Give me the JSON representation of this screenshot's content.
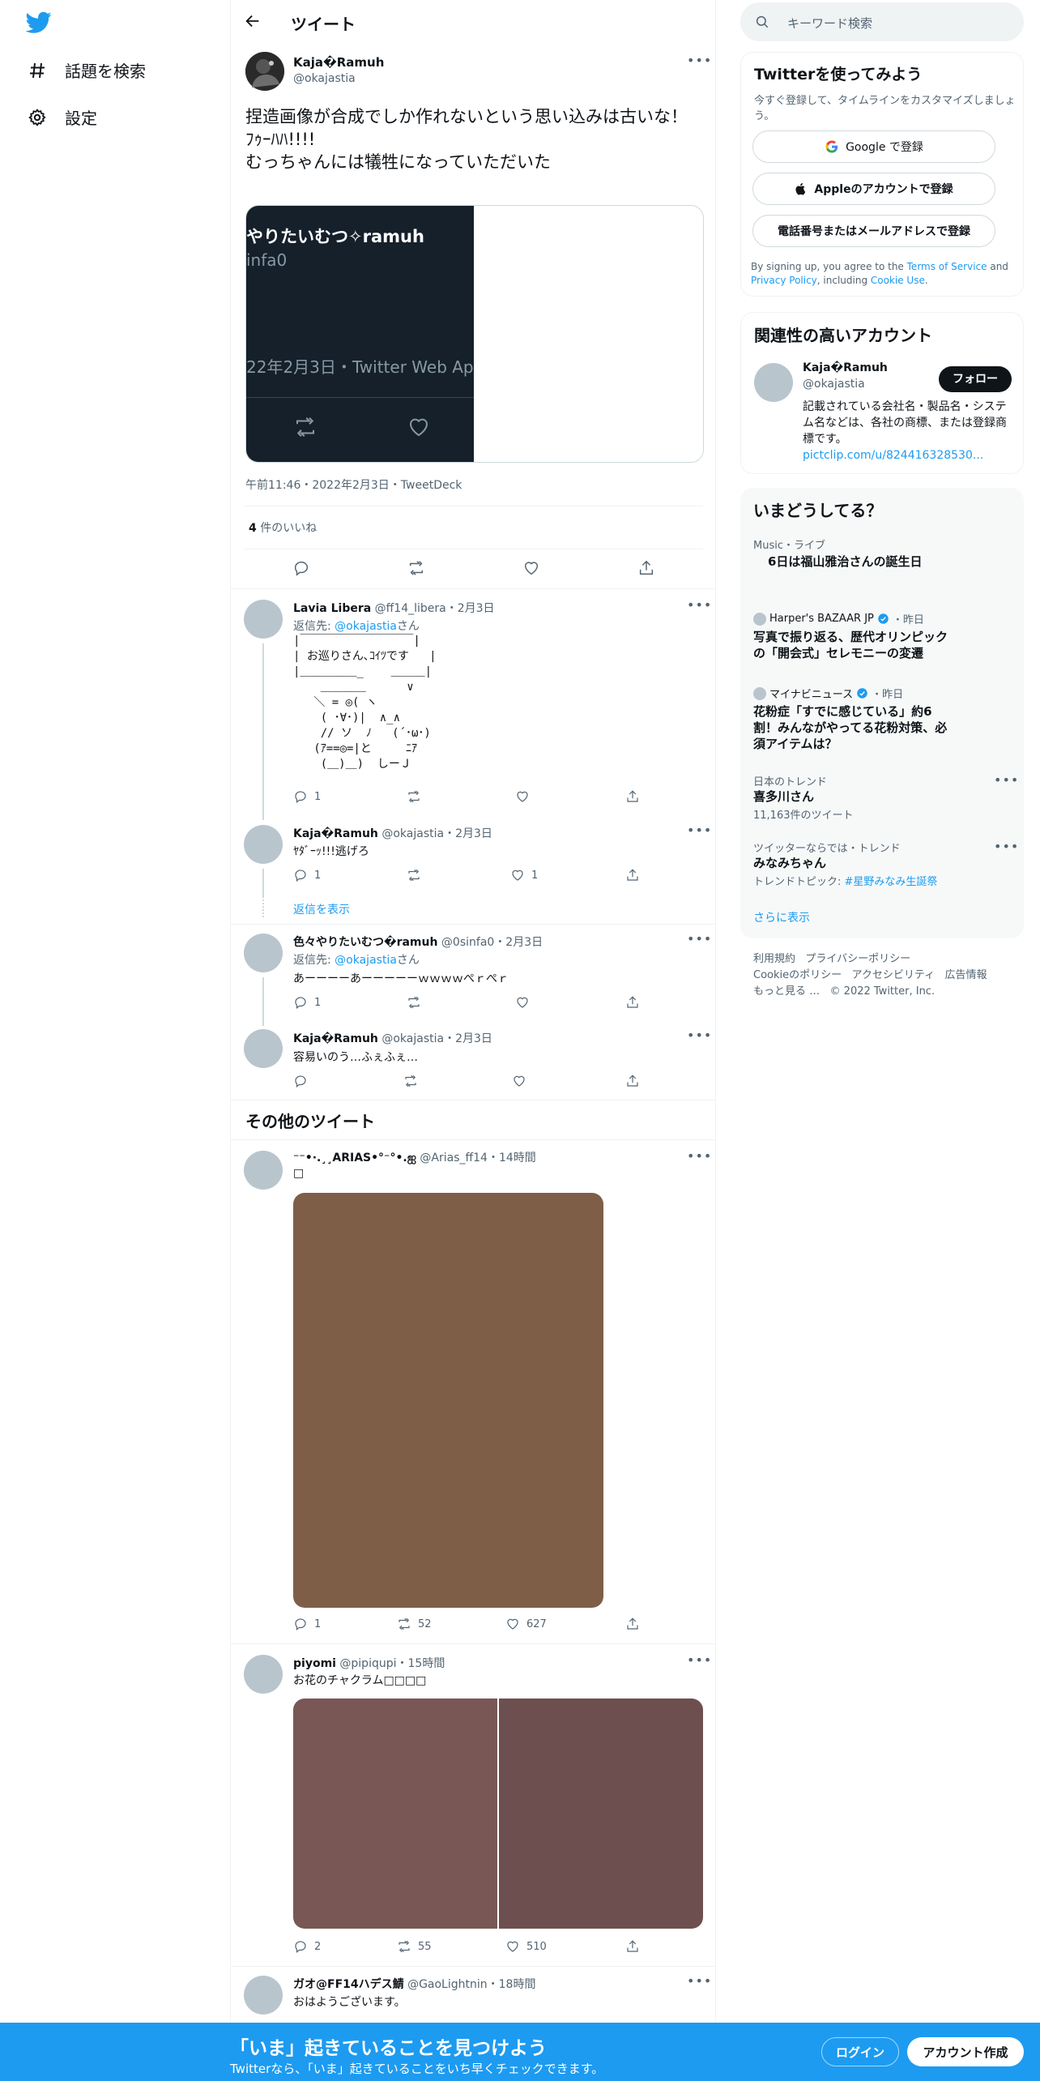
{
  "nav": {
    "explore": "話題を検索",
    "settings": "設定"
  },
  "header": {
    "title": "ツイート"
  },
  "main_tweet": {
    "name": "Kaja�Ramuh",
    "handle": "@okajastia",
    "text_line1": "捏造画像が合成でしか作れないという思い込みは古いな！",
    "text_line2": "ﾌｩｰﾊﾊ!!!!",
    "text_line3": "むっちゃんには犠牲になっていただいた",
    "embed_name": "やりたいむつ✧ramuh",
    "embed_handle": "infa0",
    "embed_meta": "22年2月3日・Twitter Web Ap",
    "timestamp": "午前11:46・2022年2月3日・TweetDeck",
    "likes_count": "4",
    "likes_label": "件のいいね"
  },
  "replies": [
    {
      "name": "Lavia Libera",
      "handle": "@ff14_libera",
      "date": "・2月3日",
      "reply_to_label": "返信先: ",
      "reply_to_handle": "@okajastia",
      "reply_to_suffix": "さん",
      "art": "|￣￣￣￣￣￣￣￣￣￣|\n| お巡りさん､ｺｲﾂです   |\n|＿＿＿＿＿_    ＿＿＿|\n    ＿＿＿＿      ∨\n   ＼ = ◎( ヽ\n    ( ･∀･)|  ∧_∧\n    // ソ  ﾉ   (´･ω･)\n   (ｱ==◎=|と     ﾆｱ\n    (＿)＿)  しーＪ",
      "reply_count": "1",
      "retweet_count": "",
      "like_count": ""
    },
    {
      "name": "Kaja�Ramuh",
      "handle": "@okajastia",
      "date": "・2月3日",
      "text": "ﾔﾀﾞｰｯ!!!逃げろ",
      "reply_count": "1",
      "retweet_count": "",
      "like_count": "1"
    },
    {
      "name": "色々やりたいむつ�ramuh",
      "handle": "@0sinfa0",
      "date": "・2月3日",
      "reply_to_label": "返信先: ",
      "reply_to_handle": "@okajastia",
      "reply_to_suffix": "さん",
      "text": "あーーーーあーーーーーｗｗｗｗぺｒぺｒ",
      "reply_count": "1",
      "retweet_count": "",
      "like_count": ""
    },
    {
      "name": "Kaja�Ramuh",
      "handle": "@okajastia",
      "date": "・2月3日",
      "text": "容易いのう…ふぇふぇ…",
      "reply_count": "",
      "retweet_count": "",
      "like_count": ""
    }
  ],
  "show_replies": "返信を表示",
  "more_tweets_title": "その他のツイート",
  "more_tweets": [
    {
      "name": "⁻⁻•·.¸¸ARIAS•°⁻°•.ஐ",
      "handle": "@Arias_ff14",
      "date": "・14時間",
      "text": "□",
      "image_color": "#7f5e48",
      "reply_count": "1",
      "retweet_count": "52",
      "like_count": "627"
    },
    {
      "name": "piyomi",
      "handle": "@pipiqupi",
      "date": "・15時間",
      "text": "お花のチャクラム□□□□",
      "image_color_left": "#785755",
      "image_color_right": "#6e4f4f",
      "reply_count": "2",
      "retweet_count": "55",
      "like_count": "510"
    },
    {
      "name": "ガオ@FF14ハデス鯖",
      "handle": "@GaoLightnin",
      "date": "・18時間",
      "text": "おはようございます。"
    }
  ],
  "right": {
    "search_placeholder": "キーワード検索",
    "signup": {
      "title": "Twitterを使ってみよう",
      "sub": "今すぐ登録して、タイムラインをカスタマイズしましょう。",
      "google": "Google で登録",
      "apple": "Appleのアカウントで登録",
      "phone": "電話番号またはメールアドレスで登録",
      "legal_1": "By signing up, you agree to the ",
      "tos": "Terms of Service",
      "legal_2": " and ",
      "privacy": "Privacy Policy",
      "legal_3": ", including ",
      "cookie": "Cookie Use",
      "legal_4": "."
    },
    "related": {
      "title": "関連性の高いアカウント",
      "name": "Kaja�Ramuh",
      "handle": "@okajastia",
      "follow": "フォロー",
      "bio": "記載されている会社名・製品名・システム名などは、各社の商標、または登録商標です。",
      "bio_link": "pictclip.com/u/824416328530..."
    },
    "trends": {
      "title": "いまどうしてる？",
      "t1_meta": "Music・ライブ",
      "t1_title": "6日は福山雅治さんの誕生日",
      "t2_source": "Harper's BAZAAR JP",
      "t2_time": "・昨日",
      "t2_title": "写真で振り返る、歴代オリンピックの「開会式」セレモニーの変遷",
      "t3_source": "マイナビニュース",
      "t3_time": "・昨日",
      "t3_title": "花粉症「すでに感じている」約6割！みんながやってる花粉対策、必須アイテムは？",
      "t4_meta": "日本のトレンド",
      "t4_title": "喜多川さん",
      "t4_count": "11,163件のツイート",
      "t5_meta": "ツイッターならでは・トレンド",
      "t5_title": "みなみちゃん",
      "t5_topic_label": "トレンドトピック: ",
      "t5_topic": "#星野みなみ生誕祭",
      "show_more": "さらに表示"
    },
    "footer": {
      "l1": "利用規約",
      "l2": "プライバシーポリシー",
      "l3": "Cookieのポリシー",
      "l4": "アクセシビリティ",
      "l5": "広告情報",
      "l6": "もっと見る …",
      "copyright": "© 2022 Twitter, Inc."
    }
  },
  "bottom_bar": {
    "title": "「いま」起きていることを見つけよう",
    "sub": "Twitterなら、「いま」起きていることをいち早くチェックできます。",
    "login": "ログイン",
    "signup": "アカウント作成"
  },
  "colors": {
    "accent": "#1d9bf0",
    "text": "#0f1419",
    "secondary": "#536471",
    "border": "#eff3f4"
  }
}
